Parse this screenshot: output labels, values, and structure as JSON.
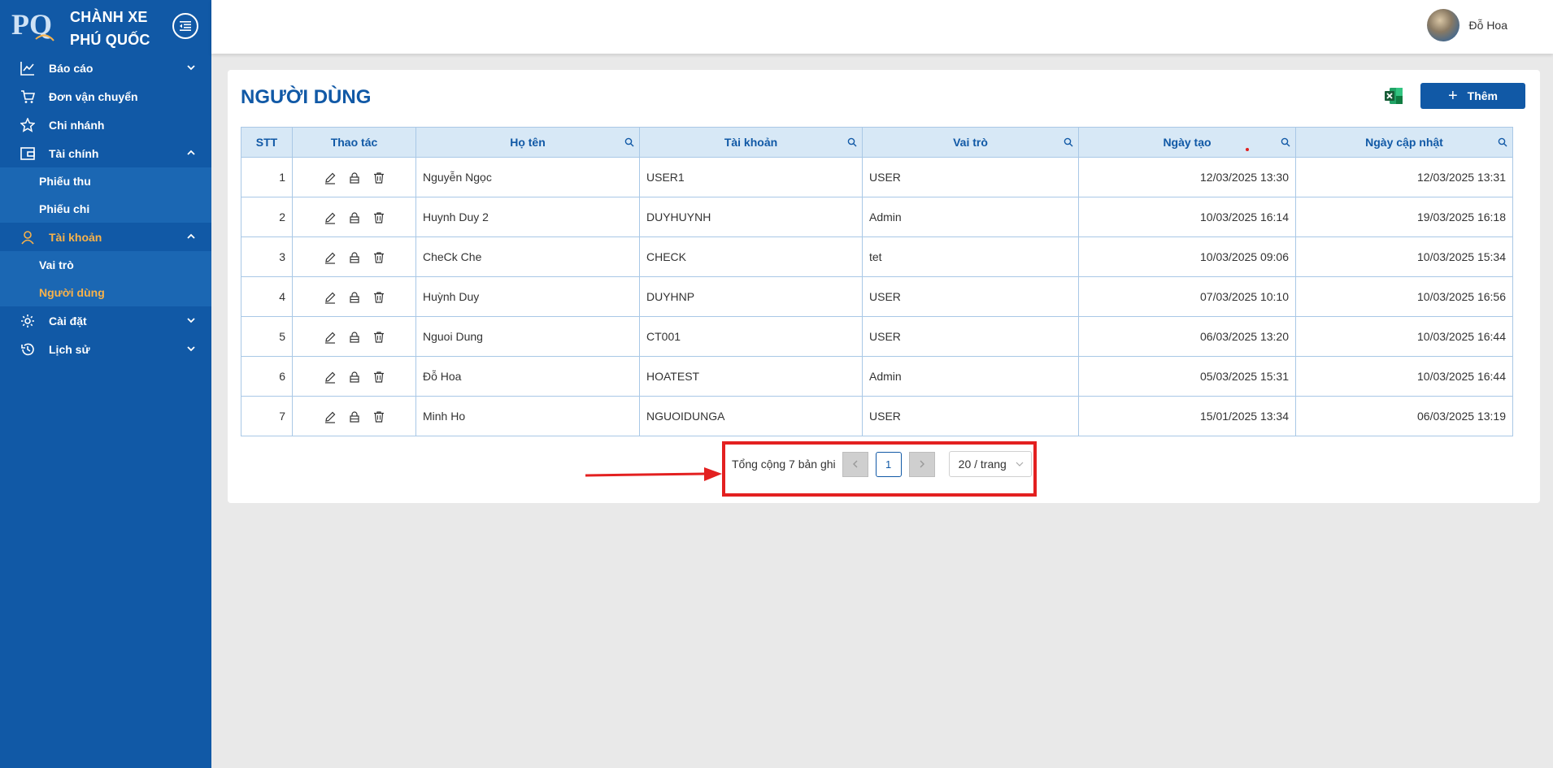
{
  "brand": {
    "line1": "CHÀNH XE",
    "line2": "PHÚ QUỐC",
    "logo_text": "PQ"
  },
  "sidebar": {
    "items": [
      {
        "label": "Báo cáo"
      },
      {
        "label": "Đơn vận chuyển"
      },
      {
        "label": "Chi nhánh"
      },
      {
        "label": "Tài chính",
        "sub": [
          "Phiếu thu",
          "Phiếu chi"
        ]
      },
      {
        "label": "Tài khoản",
        "sub": [
          "Vai trò",
          "Người dùng"
        ]
      },
      {
        "label": "Cài đặt"
      },
      {
        "label": "Lịch sử"
      }
    ]
  },
  "header": {
    "user_name": "Đỗ Hoa"
  },
  "page": {
    "title": "NGƯỜI DÙNG",
    "add_label": "Thêm"
  },
  "table": {
    "columns": [
      "STT",
      "Thao tác",
      "Họ tên",
      "Tài khoản",
      "Vai trò",
      "Ngày tạo",
      "Ngày cập nhật"
    ],
    "rows": [
      {
        "stt": "1",
        "name": "Nguyễn Ngọc",
        "account": "USER1",
        "role": "USER",
        "created": "12/03/2025 13:30",
        "updated": "12/03/2025 13:31"
      },
      {
        "stt": "2",
        "name": "Huynh Duy 2",
        "account": "DUYHUYNH",
        "role": "Admin",
        "created": "10/03/2025 16:14",
        "updated": "19/03/2025 16:18"
      },
      {
        "stt": "3",
        "name": "CheCk Che",
        "account": "CHECK",
        "role": "tet",
        "created": "10/03/2025 09:06",
        "updated": "10/03/2025 15:34"
      },
      {
        "stt": "4",
        "name": "Huỳnh Duy",
        "account": "DUYHNP",
        "role": "USER",
        "created": "07/03/2025 10:10",
        "updated": "10/03/2025 16:56"
      },
      {
        "stt": "5",
        "name": "Nguoi Dung",
        "account": "CT001",
        "role": "USER",
        "created": "06/03/2025 13:20",
        "updated": "10/03/2025 16:44"
      },
      {
        "stt": "6",
        "name": "Đỗ Hoa",
        "account": "HOATEST",
        "role": "Admin",
        "created": "05/03/2025 15:31",
        "updated": "10/03/2025 16:44"
      },
      {
        "stt": "7",
        "name": "Minh Ho",
        "account": "NGUOIDUNGA",
        "role": "USER",
        "created": "15/01/2025 13:34",
        "updated": "06/03/2025 13:19"
      }
    ]
  },
  "pagination": {
    "total_label": "Tổng cộng 7 bản ghi",
    "current_page": "1",
    "page_size": "20 / trang"
  },
  "colors": {
    "primary": "#1159a6",
    "accent": "#f8b24a",
    "highlight": "#e32020"
  }
}
